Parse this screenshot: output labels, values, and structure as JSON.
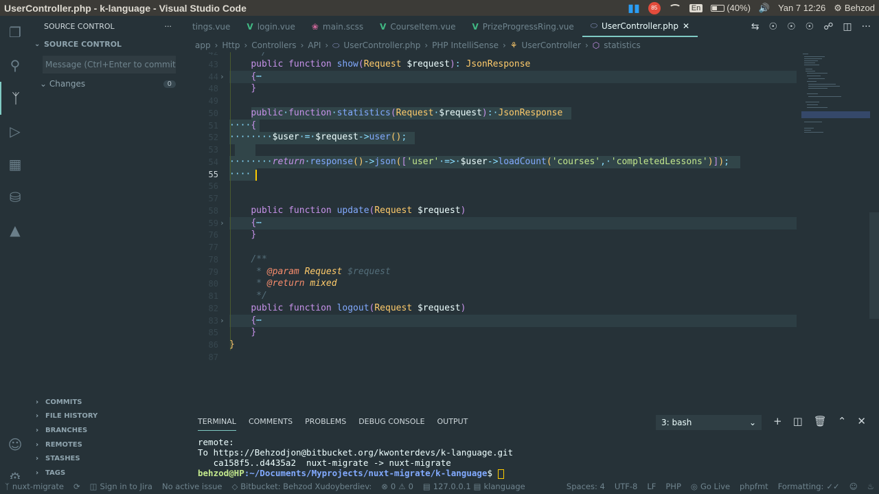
{
  "window": {
    "title": "UserController.php - k-language - Visual Studio Code"
  },
  "tray": {
    "battery": "(40%)",
    "datetime": "Yan  7 12:26",
    "user": "Behzod",
    "lang": "En",
    "notif_count": "85"
  },
  "sidebar": {
    "header": "SOURCE CONTROL",
    "section": "SOURCE CONTROL",
    "message_placeholder": "Message (Ctrl+Enter to commit ...",
    "changes_label": "Changes",
    "changes_count": "0",
    "bottom_sections": [
      "COMMITS",
      "FILE HISTORY",
      "BRANCHES",
      "REMOTES",
      "STASHES",
      "TAGS"
    ]
  },
  "tabs": [
    {
      "label": "tings.vue",
      "icon": "none"
    },
    {
      "label": "login.vue",
      "icon": "vue-icon"
    },
    {
      "label": "main.scss",
      "icon": "scss-icon"
    },
    {
      "label": "CourseItem.vue",
      "icon": "vue-icon"
    },
    {
      "label": "PrizeProgressRing.vue",
      "icon": "vue-icon"
    },
    {
      "label": "UserController.php",
      "icon": "php-icon",
      "active": true
    }
  ],
  "breadcrumbs": [
    "app",
    "Http",
    "Controllers",
    "API",
    "UserController.php",
    "PHP IntelliSense",
    "UserController",
    "statistics"
  ],
  "editor": {
    "line_numbers": [
      "42",
      "43",
      "44",
      "48",
      "49",
      "50",
      "51",
      "52",
      "53",
      "54",
      "55",
      "56",
      "57",
      "58",
      "59",
      "76",
      "77",
      "78",
      "79",
      "80",
      "81",
      "82",
      "83",
      "85",
      "86",
      "87"
    ],
    "current_line": "55"
  },
  "panel": {
    "tabs": [
      "TERMINAL",
      "COMMENTS",
      "PROBLEMS",
      "DEBUG CONSOLE",
      "OUTPUT"
    ],
    "active_tab": "TERMINAL",
    "shell": "3: bash",
    "lines": [
      "remote:",
      "To https://Behzodjon@bitbucket.org/kwonterdevs/k-language.git",
      "   ca158f5..d4435a2  nuxt-migrate -> nuxt-migrate"
    ],
    "prompt_user": "behzod@HP",
    "prompt_path": ":~/Documents/Myprojects/nuxt-migrate/k-language",
    "prompt_suffix": "$ "
  },
  "status": {
    "branch": "nuxt-migrate",
    "jira": "Sign in to Jira",
    "issue": "No active issue",
    "bitbucket": "Bitbucket: Behzod Xudoyberdiev:",
    "errors": "0",
    "warnings": "0",
    "host": "127.0.0.1",
    "project": "klanguage",
    "spaces": "Spaces: 4",
    "encoding": "UTF-8",
    "eol": "LF",
    "language": "PHP",
    "golive": "Go Live",
    "formatter": "phpfmt",
    "formatting": "Formatting: "
  },
  "colors": {
    "accent": "#80cbc4",
    "bg": "#263238",
    "cursor": "#ffcc00"
  }
}
